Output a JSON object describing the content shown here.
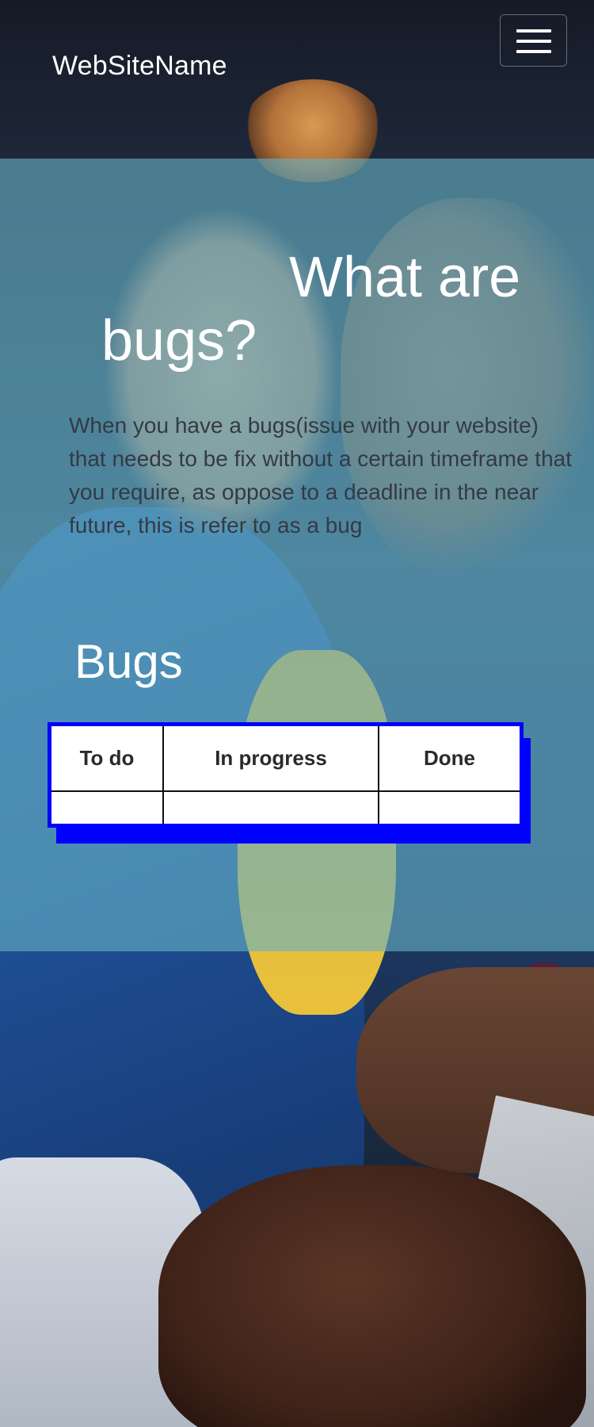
{
  "navbar": {
    "brand": "WebSiteName",
    "toggle_icon": "hamburger-menu-icon"
  },
  "hero": {
    "heading_line1": "What are",
    "heading_line2": "bugs?",
    "description": "When you have a bugs(issue with your website) that needs to be fix without a certain timeframe that you require, as oppose to a deadline in the near future, this is refer to as a bug"
  },
  "board": {
    "title": "Bugs",
    "columns": [
      "To do",
      "In progress",
      "Done"
    ],
    "rows": [
      [
        "",
        "",
        ""
      ]
    ]
  },
  "colors": {
    "panel_overlay": "#66b0c4",
    "board_border": "#0000ff",
    "heading_text": "#ffffff",
    "body_text": "#333a44"
  }
}
